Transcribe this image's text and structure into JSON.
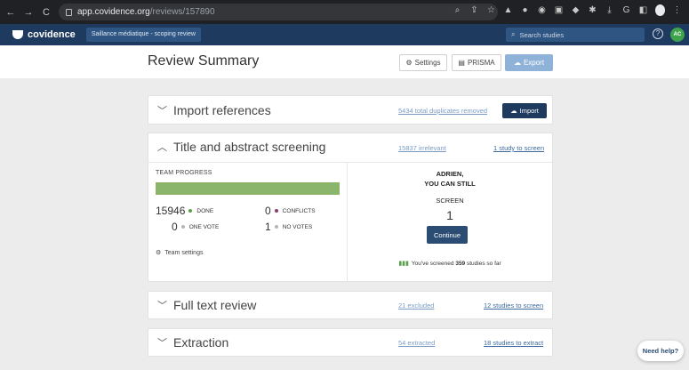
{
  "browser": {
    "url_domain": "app.covidence.org",
    "url_path": "/reviews/157890"
  },
  "app": {
    "brand": "covidence",
    "review_name": "Saillance médiatique - scoping review",
    "search_placeholder": "Search studies",
    "user_initials": "AC",
    "help_glyph": "?"
  },
  "header": {
    "title": "Review Summary",
    "settings_label": "Settings",
    "prisma_label": "PRISMA",
    "export_label": "Export"
  },
  "import_card": {
    "title": "Import references",
    "duplicates_link": "5434 total duplicates removed",
    "import_label": "Import"
  },
  "screening_card": {
    "title": "Title and abstract screening",
    "irrelevant_link": "15837 irrelevant",
    "to_screen_link": "1 study to screen",
    "team_progress_label": "TEAM PROGRESS",
    "progress_fraction": 1.0,
    "stats": {
      "done_count": "15946",
      "done_label": "DONE",
      "conflicts_count": "0",
      "conflicts_label": "CONFLICTS",
      "one_vote_count": "0",
      "one_vote_label": "ONE VOTE",
      "no_votes_count": "1",
      "no_votes_label": "NO VOTES"
    },
    "team_settings_label": "Team settings",
    "user_line1": "ADRIEN,",
    "user_line2": "YOU CAN STILL",
    "screen_label": "SCREEN",
    "screen_count": "1",
    "continue_label": "Continue",
    "screened_prefix": "You've screened ",
    "screened_count": "359",
    "screened_suffix": " studies so far"
  },
  "fulltext_card": {
    "title": "Full text review",
    "excluded_link": "21 excluded",
    "to_screen_link": "12 studies to screen"
  },
  "extraction_card": {
    "title": "Extraction",
    "extracted_link": "54 extracted",
    "to_extract_link": "18 studies to extract"
  },
  "need_help_label": "Need help?",
  "colors": {
    "navy": "#1e3a5f",
    "progress_green": "#8ab56b",
    "done_dot": "#5aa04a",
    "conflicts_dot": "#8e3b6e",
    "vote_dot": "#b5b5b5",
    "avatar_green": "#3fa34d"
  }
}
